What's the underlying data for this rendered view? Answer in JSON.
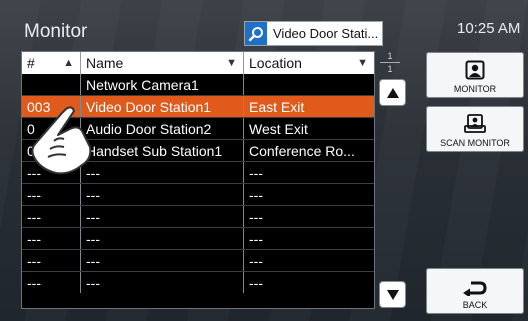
{
  "header": {
    "title": "Monitor",
    "search_value": "Video Door Stati...",
    "time": "10:25 AM"
  },
  "table": {
    "columns": [
      "#",
      "Name",
      "Location"
    ],
    "rows": [
      {
        "num": "",
        "name": "Network Camera1",
        "location": ""
      },
      {
        "num": "003",
        "name": "Video Door Station1",
        "location": "East Exit"
      },
      {
        "num": "0",
        "name": "Audio Door Station2",
        "location": "West Exit"
      },
      {
        "num": "0",
        "name": "Handset Sub Station1",
        "location": "Conference Ro..."
      },
      {
        "num": "---",
        "name": "---",
        "location": "---"
      },
      {
        "num": "---",
        "name": "---",
        "location": "---"
      },
      {
        "num": "---",
        "name": "---",
        "location": "---"
      },
      {
        "num": "---",
        "name": "---",
        "location": "---"
      },
      {
        "num": "---",
        "name": "---",
        "location": "---"
      },
      {
        "num": "---",
        "name": "---",
        "location": "---"
      }
    ],
    "selected_index": 1
  },
  "pager": {
    "current": "1",
    "total": "1"
  },
  "buttons": {
    "monitor": "MONITOR",
    "scan_monitor": "SCAN MONITOR",
    "back": "BACK"
  },
  "icons": {
    "search": "magnifier-icon",
    "monitor": "monitor-person-icon",
    "scan": "scan-monitor-icon",
    "back": "back-arrow-icon",
    "up": "up-arrow-icon",
    "down": "down-arrow-icon"
  },
  "colors": {
    "selected_row": "#e05a1b",
    "search_button": "#1e70c8"
  }
}
